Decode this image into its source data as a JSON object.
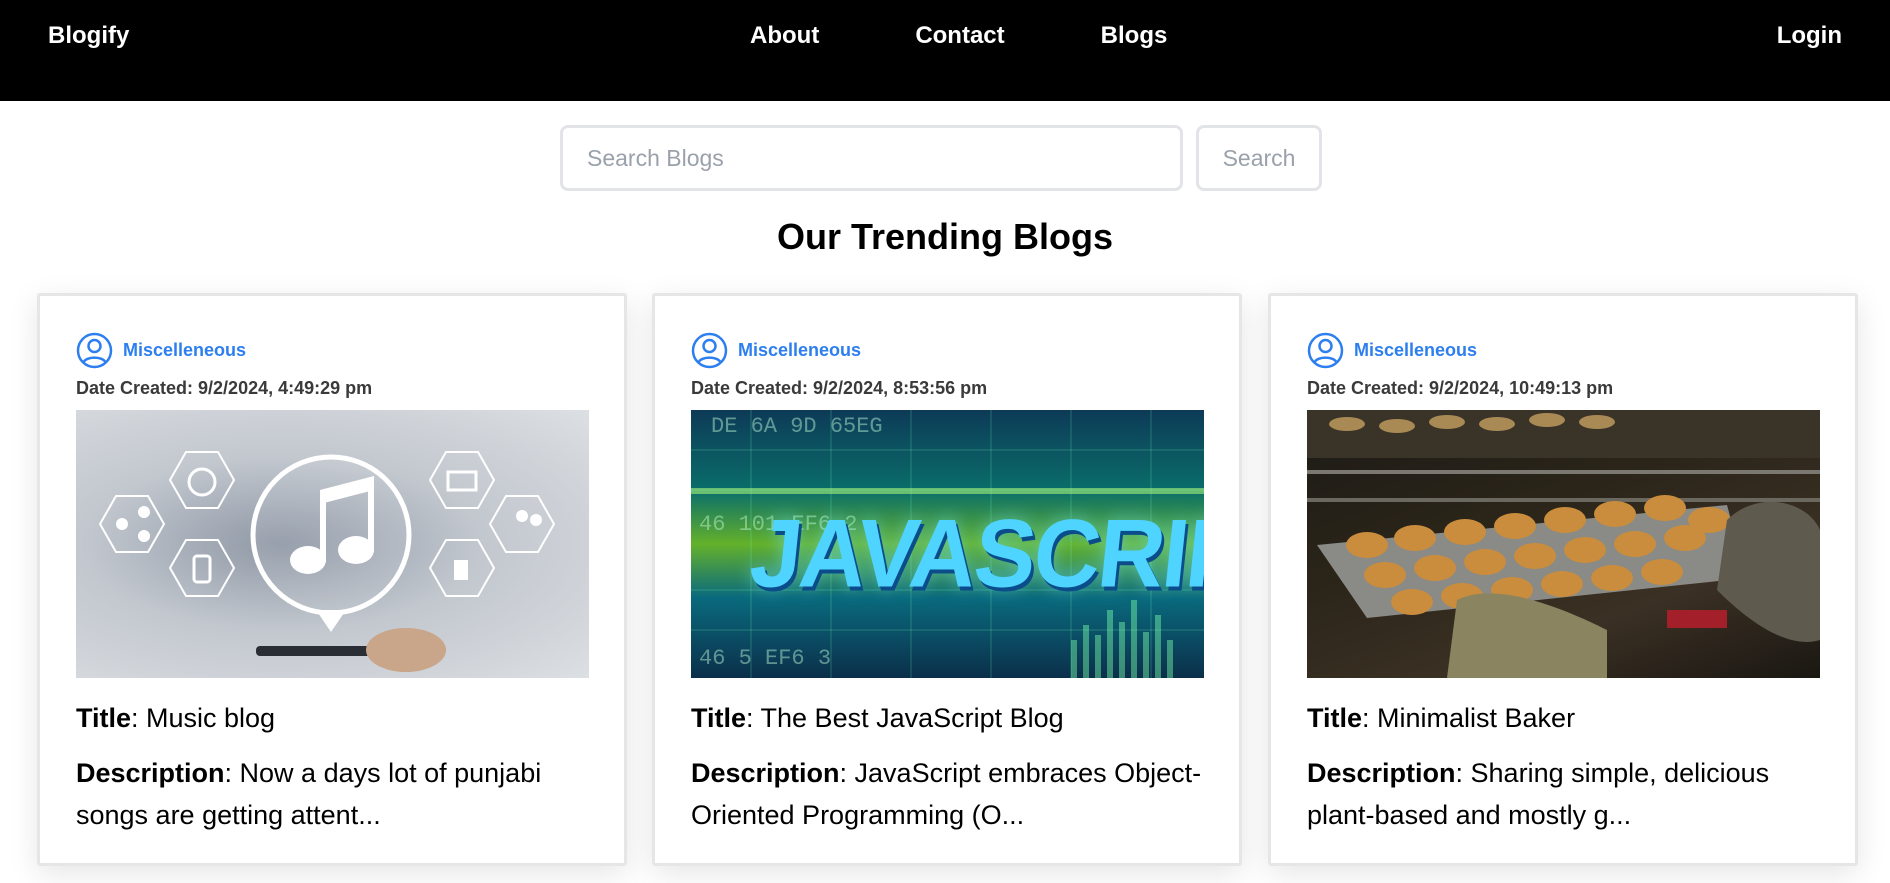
{
  "nav": {
    "brand": "Blogify",
    "links": [
      "About",
      "Contact",
      "Blogs"
    ],
    "login": "Login"
  },
  "search": {
    "placeholder": "Search Blogs",
    "button": "Search"
  },
  "section_title": "Our Trending Blogs",
  "cards": [
    {
      "author": "Miscelleneous",
      "date": "Date Created: 9/2/2024, 4:49:29 pm",
      "image_icon": "music-icon",
      "title_label": "Title",
      "title": ": Music blog",
      "desc_label": "Description",
      "desc": ": Now a days lot of punjabi songs are getting attent..."
    },
    {
      "author": "Miscelleneous",
      "date": "Date Created: 9/2/2024, 8:53:56 pm",
      "image_icon": "javascript-banner",
      "image_text": "JAVASCRIPT",
      "title_label": "Title",
      "title": ": The Best JavaScript Blog",
      "desc_label": "Description",
      "desc": ": JavaScript embraces Object-Oriented Programming (O..."
    },
    {
      "author": "Miscelleneous",
      "date": "Date Created: 9/2/2024, 10:49:13 pm",
      "image_icon": "muffins-photo",
      "title_label": "Title",
      "title": ": Minimalist Baker",
      "desc_label": "Description",
      "desc": ": Sharing simple, delicious plant-based and mostly g..."
    }
  ],
  "colors": {
    "navbar_bg": "#000000",
    "author_link": "#2d7ff0",
    "border": "#e2e4e8"
  }
}
